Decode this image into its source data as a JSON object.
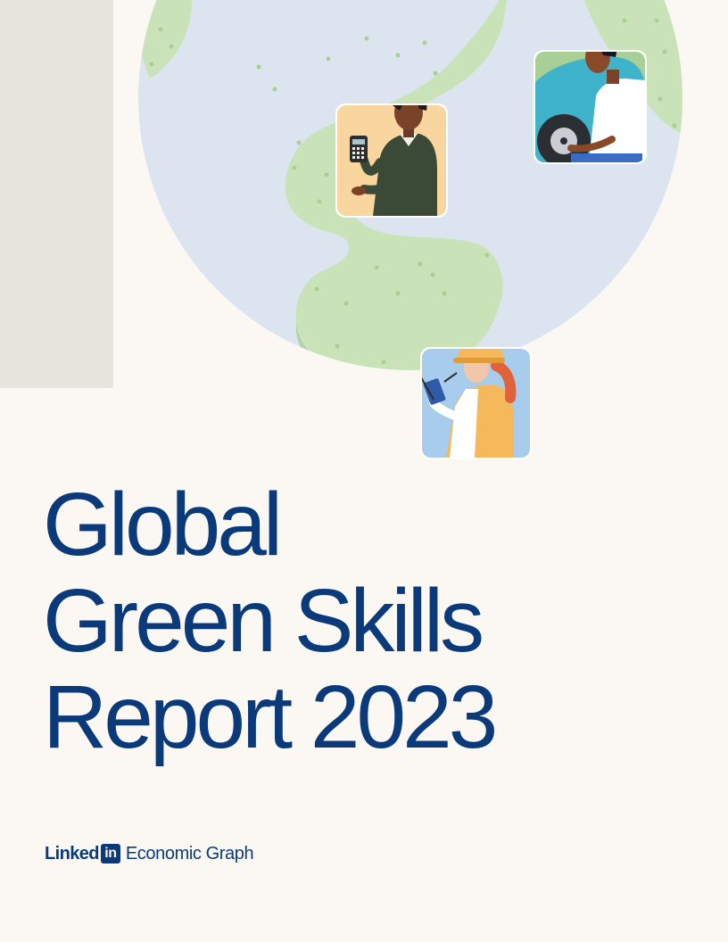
{
  "title": {
    "line1": "Global",
    "line2": "Green Skills",
    "line3": "Report 2023"
  },
  "brand": {
    "word": "Linked",
    "badge": "in",
    "subtitle": "Economic Graph"
  },
  "colors": {
    "background": "#FBF8F4",
    "side_panel": "#E7E4DE",
    "globe_water": "#DCE5EF",
    "globe_land": "#C9E2B8",
    "title": "#0B3A7A"
  },
  "illustrations": [
    "globe-illustration",
    "accountant-icon",
    "mechanic-icon",
    "engineer-icon"
  ]
}
